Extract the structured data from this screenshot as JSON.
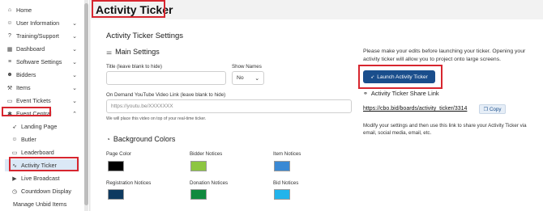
{
  "sidebar": {
    "items": [
      {
        "label": "Home",
        "icon": "home-icon",
        "glyph": "⌂",
        "chevron": ""
      },
      {
        "label": "User Information",
        "icon": "user-icon",
        "glyph": "☺",
        "chevron": "⌄"
      },
      {
        "label": "Training/Support",
        "icon": "question-icon",
        "glyph": "?",
        "chevron": "⌄"
      },
      {
        "label": "Dashboard",
        "icon": "dashboard-icon",
        "glyph": "▦",
        "chevron": "⌄"
      },
      {
        "label": "Software Settings",
        "icon": "sliders-icon",
        "glyph": "≡",
        "chevron": "⌄"
      },
      {
        "label": "Bidders",
        "icon": "bidders-icon",
        "glyph": "☻",
        "chevron": "⌄"
      },
      {
        "label": "Items",
        "icon": "gavel-icon",
        "glyph": "⚒",
        "chevron": "⌄"
      },
      {
        "label": "Event Tickets",
        "icon": "ticket-icon",
        "glyph": "▭",
        "chevron": "⌄"
      },
      {
        "label": "Event Central",
        "icon": "event-central-icon",
        "glyph": "✱",
        "chevron": "⌃"
      }
    ],
    "subitems": [
      {
        "label": "Landing Page",
        "icon": "rocket-icon",
        "glyph": "➶"
      },
      {
        "label": "Butler",
        "icon": "butler-icon",
        "glyph": "☺"
      },
      {
        "label": "Leaderboard",
        "icon": "leaderboard-icon",
        "glyph": "▭"
      },
      {
        "label": "Activity Ticker",
        "icon": "activity-icon",
        "glyph": "∿"
      },
      {
        "label": "Live Broadcast",
        "icon": "broadcast-icon",
        "glyph": "▶"
      },
      {
        "label": "Countdown Display",
        "icon": "clock-icon",
        "glyph": "◷"
      },
      {
        "label": "Manage Unbid Items",
        "icon": "",
        "glyph": ""
      }
    ]
  },
  "header": {
    "title": "Activity Ticker"
  },
  "main": {
    "settings_title": "Activity Ticker Settings",
    "main_settings": "Main Settings",
    "title_label": "Title (leave blank to hide)",
    "title_value": "",
    "show_names_label": "Show Names",
    "show_names_value": "No",
    "video_label": "On Demand YouTube Video Link (leave blank to hide)",
    "video_placeholder": "https://youtu.be/XXXXXXX",
    "video_helper": "We will place this video on top of your real-time ticker.",
    "bg_colors": "Background Colors",
    "colors": [
      {
        "label": "Page Color",
        "hex": "#000000"
      },
      {
        "label": "Bidder Notices",
        "hex": "#8dc641"
      },
      {
        "label": "Item Notices",
        "hex": "#3a89d4"
      },
      {
        "label": "Registration Notices",
        "hex": "#0e3a60"
      },
      {
        "label": "Donation Notices",
        "hex": "#0f8a3e"
      },
      {
        "label": "Bid Notices",
        "hex": "#22b4ec"
      }
    ]
  },
  "right": {
    "info": "Please make your edits before launching your ticker. Opening your activity ticker will allow you to project onto large screens.",
    "launch_label": "Launch Activity Ticker",
    "share_title": "Activity Ticker Share Link",
    "share_link": "https://cbo.bid/boards/activity_ticker/3314",
    "copy_label": "Copy",
    "modify": "Modify your settings and then use this link to share your Activity Ticker via email, social media, email, etc."
  },
  "colors": {
    "accent": "#1a4e8c",
    "highlight_box": "#d7262f",
    "active_bg": "#dbe8f6"
  }
}
